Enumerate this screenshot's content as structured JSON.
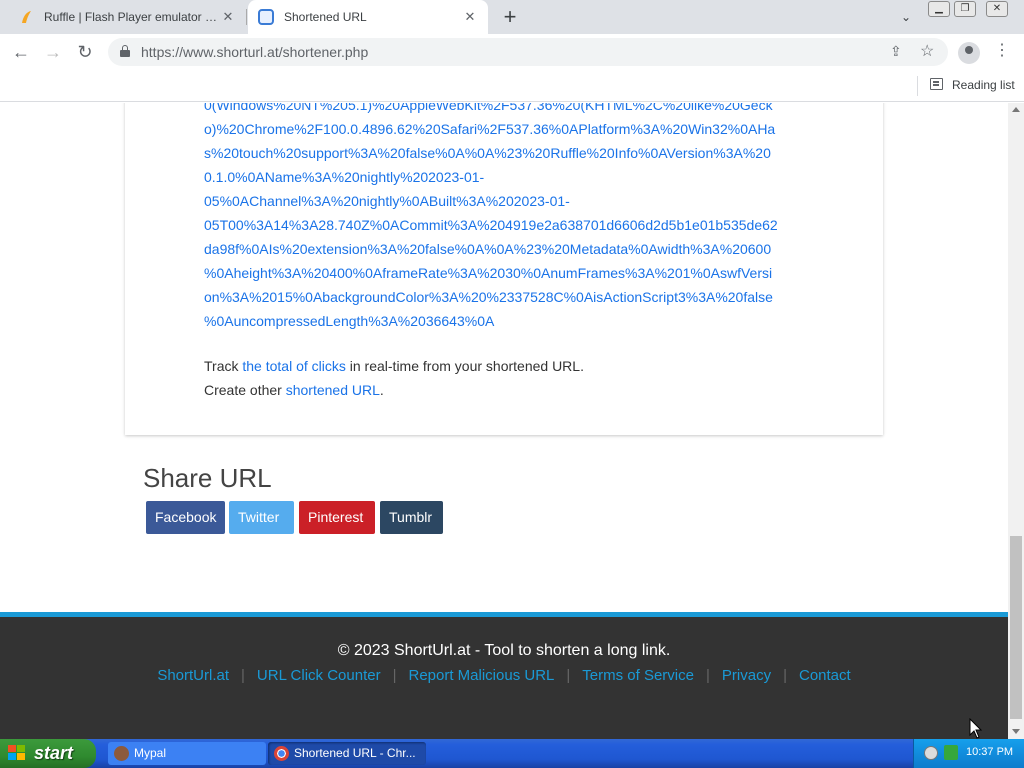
{
  "browser": {
    "tabs": [
      {
        "title": "Ruffle | Flash Player emulator writte",
        "active": false
      },
      {
        "title": "Shortened URL",
        "active": true
      }
    ],
    "url": "https://www.shorturl.at/shortener.php",
    "reading_list_label": "Reading list"
  },
  "page": {
    "long_link_lines": [
      "0(Windows%20NT%205.1)%20AppleWebKit%2F537.36%20(KHTML%2C%20like%20Geck",
      "o)%20Chrome%2F100.0.4896.62%20Safari%2F537.36%0APlatform%3A%20Win32%0AHa",
      "s%20touch%20support%3A%20false%0A%0A%23%20Ruffle%20Info%0AVersion%3A%20",
      "0.1.0%0AName%3A%20nightly%202023-01-",
      "05%0AChannel%3A%20nightly%0ABuilt%3A%202023-01-",
      "05T00%3A14%3A28.740Z%0ACommit%3A%204919e2a638701d6606d2d5b1e01b535de62",
      "da98f%0AIs%20extension%3A%20false%0A%0A%23%20Metadata%0Awidth%3A%20600",
      "%0Aheight%3A%20400%0AframeRate%3A%2030%0AnumFrames%3A%201%0AswfVersi",
      "on%3A%2015%0AbackgroundColor%3A%20%2337528C%0AisActionScript3%3A%20false",
      "%0AuncompressedLength%3A%2036643%0A"
    ],
    "track_prefix": "Track ",
    "track_link": "the total of clicks",
    "track_suffix": " in real-time from your shortened URL.",
    "create_prefix": "Create other ",
    "create_link": "shortened URL",
    "create_suffix": ".",
    "share_title": "Share URL",
    "share_buttons": [
      "Facebook",
      "Twitter",
      "Pinterest",
      "Tumblr"
    ],
    "footer": {
      "copyright": "© 2023 ShortUrl.at - Tool to shorten a long link.",
      "links": [
        "ShortUrl.at",
        "URL Click Counter",
        "Report Malicious URL",
        "Terms of Service",
        "Privacy",
        "Contact"
      ]
    }
  },
  "taskbar": {
    "start_label": "start",
    "items": [
      "Mypal",
      "Shortened URL - Chr..."
    ],
    "clock": "10:37 PM"
  },
  "colors": {
    "link": "#1a73e8",
    "footer_accent": "#1a9ad6",
    "facebook": "#3b5998",
    "twitter": "#55acee",
    "pinterest": "#cb2027",
    "tumblr": "#2c4762"
  }
}
